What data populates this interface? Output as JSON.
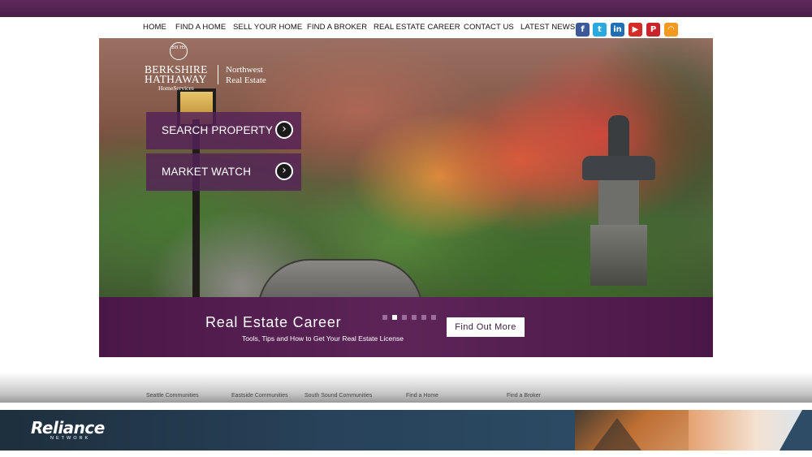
{
  "nav": {
    "items": [
      "HOME",
      "FIND A HOME",
      "SELL YOUR HOME",
      "FIND A BROKER",
      "REAL ESTATE CAREER",
      "CONTACT US",
      "LATEST NEWS"
    ]
  },
  "social": [
    {
      "name": "facebook-icon",
      "glyph": "f",
      "color": "#3b5998"
    },
    {
      "name": "twitter-icon",
      "glyph": "t",
      "color": "#2aa9e0"
    },
    {
      "name": "linkedin-icon",
      "glyph": "in",
      "color": "#1f6fb2"
    },
    {
      "name": "youtube-icon",
      "glyph": "▶",
      "color": "#d42b27"
    },
    {
      "name": "pinterest-icon",
      "glyph": "P",
      "color": "#c9232d"
    },
    {
      "name": "rss-icon",
      "glyph": "◠",
      "color": "#f39a1e"
    }
  ],
  "logo": {
    "seal": "BH HS",
    "line1": "BERKSHIRE",
    "line2": "HATHAWAY",
    "line3": "HomeServices",
    "region1": "Northwest",
    "region2": "Real Estate"
  },
  "hero": {
    "search_label": "SEARCH PROPERTY",
    "market_label": "MARKET WATCH",
    "arrow_glyph": "›"
  },
  "banner": {
    "title": "Real Estate Career",
    "subtitle": "Tools, Tips and How to Get Your Real Estate License",
    "cta": "Find Out More",
    "slide_count": 6,
    "active_slide": 2
  },
  "footer_links": [
    "Seattle Communities",
    "Eastside Communities",
    "South Sound Communities",
    "Find a Home",
    "Find a Broker"
  ],
  "reliance": {
    "brand": "Reliance",
    "sub": "NETWORK"
  }
}
